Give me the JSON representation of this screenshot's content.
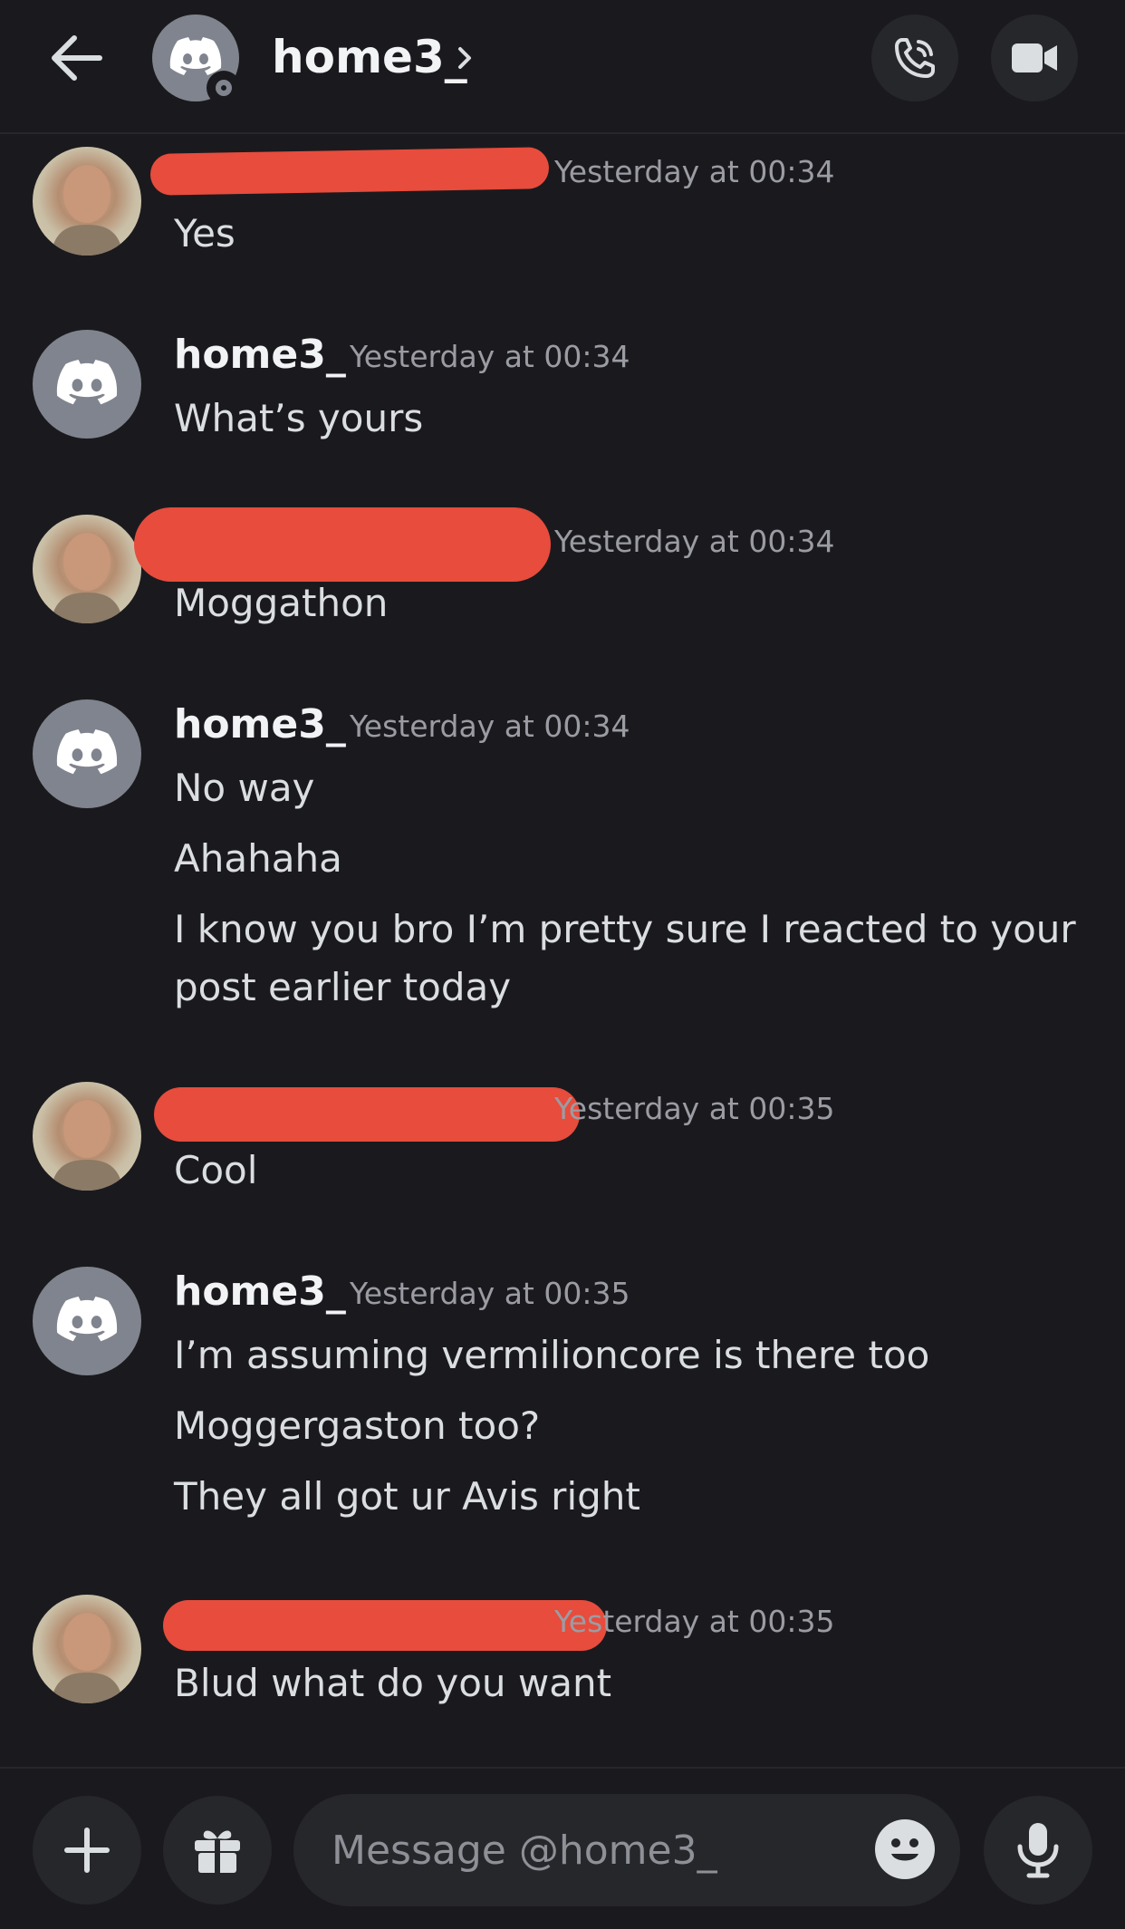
{
  "header": {
    "name": "home3_",
    "chevron": "›",
    "back_icon": "arrow-left-icon",
    "call_icon": "phone-call-icon",
    "video_icon": "video-camera-icon"
  },
  "messages": [
    {
      "author": "",
      "timestamp": "Yesterday at 00:34",
      "lines": [
        "Yes"
      ],
      "redacted": true
    },
    {
      "author": "home3_",
      "timestamp": "Yesterday at 00:34",
      "lines": [
        "What’s yours"
      ],
      "redacted": false
    },
    {
      "author": "",
      "timestamp": "Yesterday at 00:34",
      "lines": [
        "Moggathon"
      ],
      "redacted": true
    },
    {
      "author": "home3_",
      "timestamp": "Yesterday at 00:34",
      "lines": [
        "No way",
        "Ahahaha",
        "I know you bro I’m pretty sure I reacted to your post earlier today"
      ],
      "redacted": false
    },
    {
      "author": "",
      "timestamp": "Yesterday at 00:35",
      "lines": [
        "Cool"
      ],
      "redacted": true
    },
    {
      "author": "home3_",
      "timestamp": "Yesterday at 00:35",
      "lines": [
        "I’m assuming vermilioncore is there too",
        "Moggergaston too?",
        "They all got ur Avis right"
      ],
      "redacted": false
    },
    {
      "author": "",
      "timestamp": "Yesterday at 00:35",
      "lines": [
        "Blud what do you want"
      ],
      "redacted": true
    }
  ],
  "composer": {
    "placeholder": "Message @home3_",
    "plus_icon": "plus-icon",
    "gift_icon": "gift-icon",
    "emoji_icon": "emoji-icon",
    "mic_icon": "microphone-icon"
  },
  "colors": {
    "background": "#1a1a1e",
    "redaction": "#e74c3c",
    "avatar_gray": "#80848e"
  }
}
